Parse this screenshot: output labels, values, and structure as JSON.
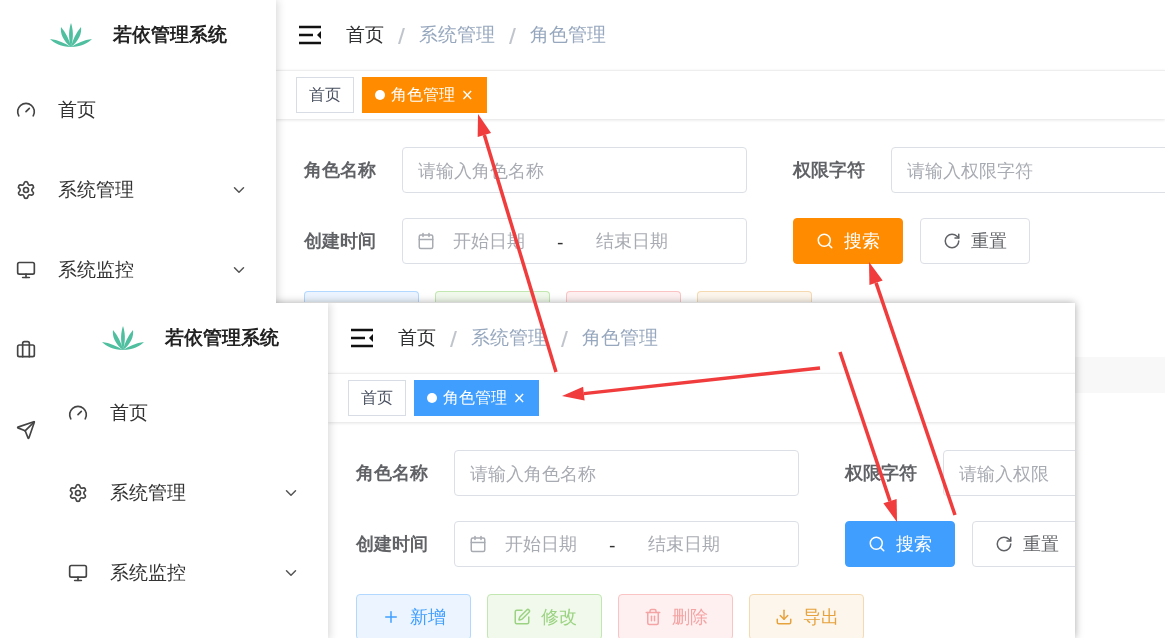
{
  "screens": [
    {
      "color": "#ff8c00",
      "brand": "若依管理系统",
      "sidebar": {
        "items": [
          {
            "kind": "link",
            "label": "首页"
          },
          {
            "kind": "submenu",
            "label": "系统管理",
            "expanded": false
          },
          {
            "kind": "submenu",
            "label": "系统监控",
            "expanded": false
          },
          {
            "kind": "icon-only"
          },
          {
            "kind": "icon-only"
          }
        ]
      },
      "breadcrumb": [
        "首页",
        "系统管理",
        "角色管理"
      ],
      "tags": [
        {
          "label": "首页",
          "selected": false
        },
        {
          "label": "角色管理",
          "selected": true,
          "close": "×"
        }
      ],
      "form": {
        "fields": [
          {
            "kind": "text",
            "label": "角色名称",
            "placeholder": "请输入角色名称"
          },
          {
            "kind": "text",
            "label": "权限字符",
            "placeholder": "请输入权限字符"
          },
          {
            "kind": "daterange",
            "label": "创建时间",
            "start_placeholder": "开始日期",
            "separator": "-",
            "end_placeholder": "结束日期"
          }
        ],
        "search": "搜索",
        "reset": "重置"
      },
      "buttons": [
        {
          "kind": "add"
        },
        {
          "kind": "edit"
        },
        {
          "kind": "delete"
        },
        {
          "kind": "export"
        }
      ],
      "breadcrumb_separator": "/",
      "table": {
        "header": true
      }
    },
    {
      "color": "#409eff",
      "brand": "若依管理系统",
      "sidebar": {
        "items": [
          {
            "kind": "link",
            "label": "首页"
          },
          {
            "kind": "submenu",
            "label": "系统管理",
            "expanded": false
          },
          {
            "kind": "submenu",
            "label": "系统监控",
            "expanded": false
          }
        ]
      },
      "breadcrumb": [
        "首页",
        "系统管理",
        "角色管理"
      ],
      "tags": [
        {
          "label": "首页",
          "selected": false
        },
        {
          "label": "角色管理",
          "selected": true,
          "close": "×"
        }
      ],
      "form": {
        "fields": [
          {
            "kind": "text",
            "label": "角色名称",
            "placeholder": "请输入角色名称"
          },
          {
            "kind": "text",
            "label": "权限字符",
            "placeholder": "请输入权限"
          },
          {
            "kind": "daterange",
            "label": "创建时间",
            "start_placeholder": "开始日期",
            "separator": "-",
            "end_placeholder": "结束日期"
          }
        ],
        "search": "搜索",
        "reset": "重置"
      },
      "breadcrumb_separator": "/",
      "buttons": [
        {
          "kind": "add",
          "label": "新增"
        },
        {
          "kind": "edit",
          "label": "修改"
        },
        {
          "kind": "delete",
          "label": "删除"
        },
        {
          "kind": "export",
          "label": "导出"
        }
      ]
    }
  ]
}
